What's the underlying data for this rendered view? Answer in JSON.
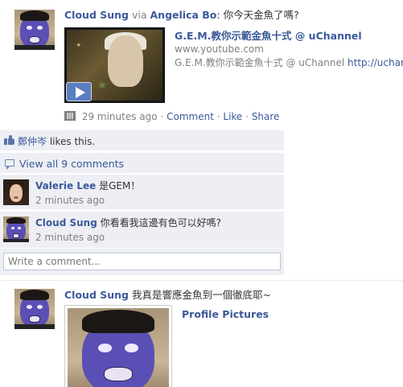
{
  "posts": [
    {
      "author": "Cloud Sung",
      "via_word": "via",
      "via_name": "Angelica Bo",
      "message": ": 你今天金魚了嗎?",
      "attachment": {
        "title": "G.E.M.教你示範金魚十式 @ uChannel",
        "domain": "www.youtube.com",
        "description": "G.E.M.教你示範金魚十式 @ uChannel",
        "desc_link": "http://uchan"
      },
      "time": "29 minutes ago",
      "separator": "·",
      "actions": {
        "comment": "Comment",
        "like": "Like",
        "share": "Share"
      },
      "likes": {
        "name": "鄭仲岑",
        "text": " likes this."
      },
      "view_all": "View all 9 comments",
      "comments": [
        {
          "author": "Valerie Lee",
          "text": " 是GEM！",
          "time": "2 minutes ago"
        },
        {
          "author": "Cloud Sung",
          "text": " 你看看我這邊有色可以好嗎?",
          "time": "2 minutes ago"
        }
      ],
      "write_placeholder": "Write a comment..."
    },
    {
      "author": "Cloud Sung",
      "message": " 我真是響應金魚到一個徹底耶~",
      "photo_album": "Profile Pictures"
    }
  ]
}
